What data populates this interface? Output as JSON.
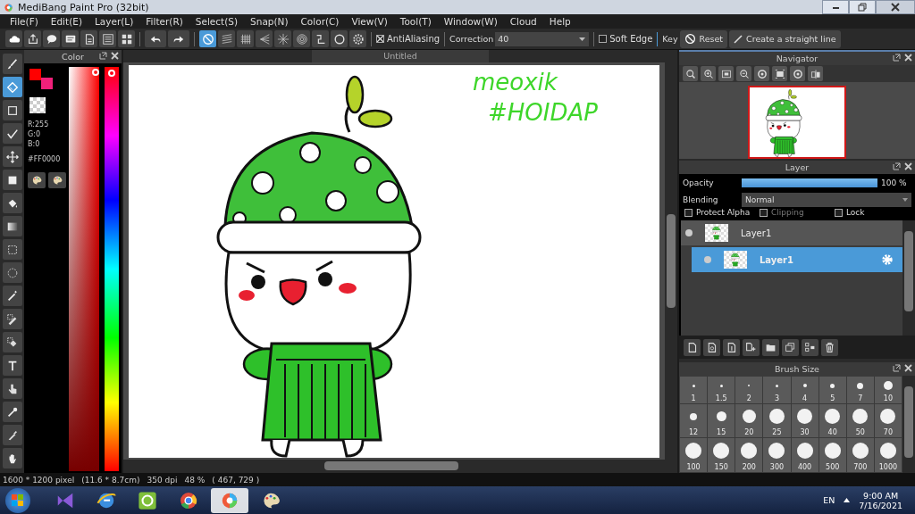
{
  "window": {
    "title": "MediBang Paint Pro (32bit)"
  },
  "menu": [
    "File(F)",
    "Edit(E)",
    "Layer(L)",
    "Filter(R)",
    "Select(S)",
    "Snap(N)",
    "Color(C)",
    "View(V)",
    "Tool(T)",
    "Window(W)",
    "Cloud",
    "Help"
  ],
  "toolbar": {
    "file_tools": [
      {
        "kind": "cloud"
      },
      {
        "kind": "upload"
      },
      {
        "kind": "bubble"
      },
      {
        "kind": "comments"
      },
      {
        "kind": "page"
      },
      {
        "kind": "list"
      },
      {
        "kind": "tiles"
      }
    ],
    "history": [
      {
        "kind": "undo"
      },
      {
        "kind": "redo"
      }
    ],
    "snaps": [
      {
        "kind": "off",
        "selected": true
      },
      {
        "kind": "parallel",
        "selected": false
      },
      {
        "kind": "grid",
        "selected": false
      },
      {
        "kind": "perspective",
        "selected": false
      },
      {
        "kind": "radial",
        "selected": false
      },
      {
        "kind": "concentric",
        "selected": false
      },
      {
        "kind": "curve",
        "selected": false
      },
      {
        "kind": "ellipse",
        "selected": false
      },
      {
        "kind": "settings",
        "selected": false
      }
    ],
    "antialiasing": {
      "label": "AntiAliasing",
      "checked": true
    },
    "correction": {
      "label": "Correction",
      "value": "40"
    },
    "soft_edge": {
      "label": "Soft Edge",
      "checked": false
    },
    "key": "Key",
    "reset": "Reset",
    "straight_line": "Create a straight line"
  },
  "tools": [
    {
      "kind": "brush",
      "selected": false
    },
    {
      "kind": "eraser",
      "selected": true
    },
    {
      "kind": "dot",
      "selected": false
    },
    {
      "kind": "polyline",
      "selected": false
    },
    {
      "kind": "move",
      "selected": false
    },
    {
      "kind": "fill",
      "selected": false
    },
    {
      "kind": "bucket",
      "selected": false
    },
    {
      "kind": "gradient",
      "selected": false
    },
    {
      "kind": "select",
      "selected": false
    },
    {
      "kind": "lasso",
      "selected": false
    },
    {
      "kind": "wand",
      "selected": false
    },
    {
      "kind": "select-pen",
      "selected": false
    },
    {
      "kind": "select-eraser",
      "selected": false
    },
    {
      "kind": "text",
      "selected": false
    },
    {
      "kind": "operation",
      "selected": false
    },
    {
      "kind": "eyedropper",
      "selected": false
    },
    {
      "kind": "pen",
      "selected": false
    },
    {
      "kind": "hand",
      "selected": false
    }
  ],
  "color_panel": {
    "title": "Color",
    "saturation_slider": {
      "level": 1
    },
    "hue_slider": {
      "level": 1
    },
    "swatches": [
      {
        "color": "#ff0000"
      },
      {
        "color": "#f0207a"
      }
    ],
    "r": "R:255",
    "g": "G:0",
    "b": "B:0",
    "hex": "#FF0000"
  },
  "canvas": {
    "tab": "Untitled",
    "handwriting": [
      "meoxik",
      "#HOIDAP"
    ]
  },
  "navigator": {
    "title": "Navigator",
    "buttons": [
      {
        "kind": "zoom-actual"
      },
      {
        "kind": "zoom-in"
      },
      {
        "kind": "fit"
      },
      {
        "kind": "zoom-out"
      },
      {
        "kind": "rotate-left"
      },
      {
        "kind": "frame"
      },
      {
        "kind": "rotate-right"
      },
      {
        "kind": "flip"
      }
    ]
  },
  "layer_panel": {
    "title": "Layer",
    "opacity_label": "Opacity",
    "opacity": {
      "level": 1,
      "reading": "100 %"
    },
    "blending_label": "Blending",
    "blending": "Normal",
    "options": [
      {
        "label": "Protect Alpha",
        "checked": false,
        "disabled": false
      },
      {
        "label": "Clipping",
        "checked": false,
        "disabled": true
      },
      {
        "label": "Lock",
        "checked": false,
        "disabled": false
      }
    ],
    "layers": [
      {
        "name": "Layer1",
        "selected": false
      },
      {
        "name": "Layer1",
        "selected": true
      }
    ],
    "buttons": [
      {
        "kind": "new"
      },
      {
        "kind": "new-8bit"
      },
      {
        "kind": "new-1bit"
      },
      {
        "kind": "add"
      },
      {
        "kind": "folder"
      },
      {
        "kind": "duplicate"
      },
      {
        "kind": "merge"
      },
      {
        "kind": "delete"
      }
    ]
  },
  "brush_size": {
    "title": "Brush Size",
    "sizes": [
      "1",
      "1.5",
      "2",
      "3",
      "4",
      "5",
      "7",
      "10",
      "12",
      "15",
      "20",
      "25",
      "30",
      "40",
      "50",
      "70",
      "100",
      "150",
      "200",
      "300",
      "400",
      "500",
      "700",
      "1000"
    ]
  },
  "status_bar": {
    "size": "1600 * 1200 pixel",
    "physical": "(11.6 * 8.7cm)",
    "dpi": "350 dpi",
    "zoom": "48 %",
    "cursor": "( 467, 729 )"
  },
  "taskbar": {
    "apps": [
      {
        "kind": "studio",
        "selected": false
      },
      {
        "kind": "browser-e",
        "selected": false
      },
      {
        "kind": "leaf",
        "selected": false
      },
      {
        "kind": "chrome",
        "selected": false
      },
      {
        "kind": "medibang",
        "selected": true
      },
      {
        "kind": "palette",
        "selected": false
      }
    ],
    "language": "EN",
    "time": "9:00 AM",
    "date": "7/16/2021"
  }
}
